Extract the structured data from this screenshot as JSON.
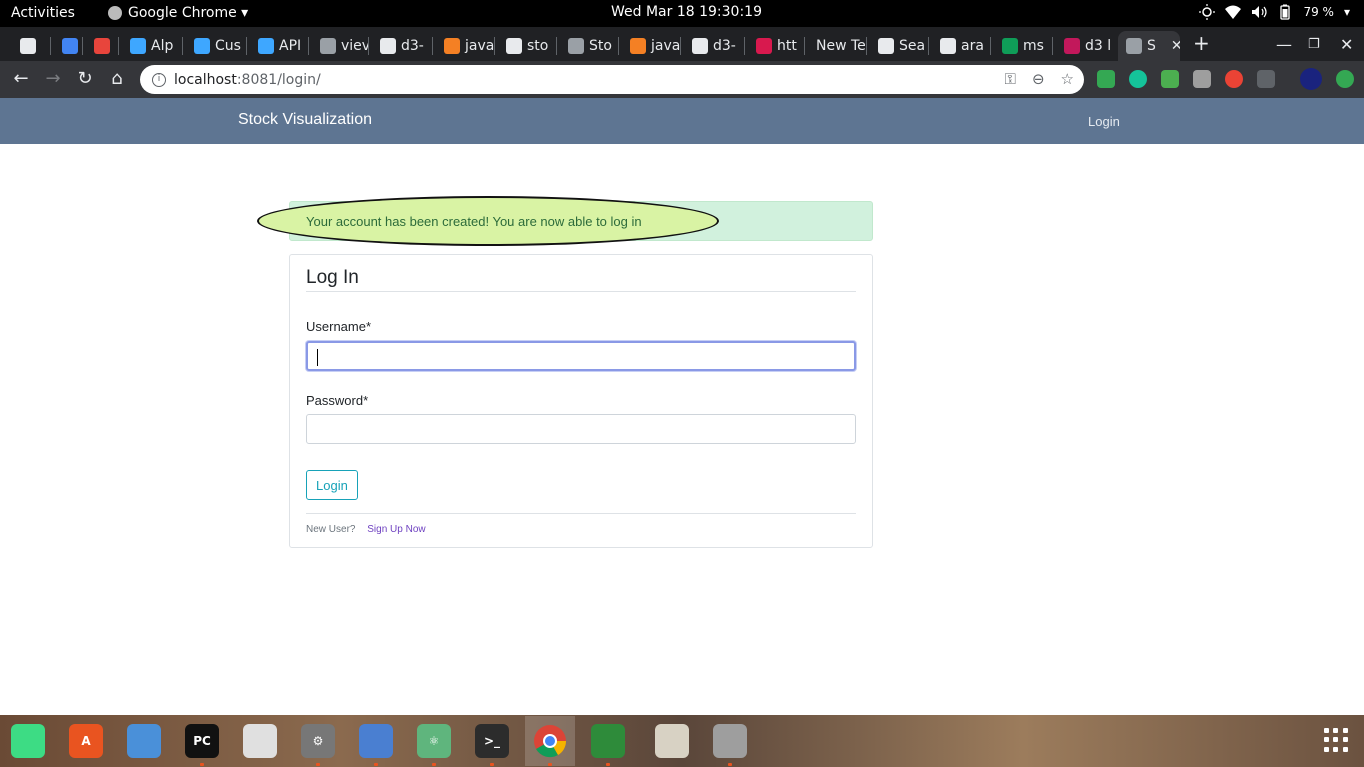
{
  "system": {
    "activities": "Activities",
    "app_menu": "Google Chrome ▾",
    "clock": "Wed Mar 18  19:30:19",
    "battery": "79 %"
  },
  "tabs": [
    {
      "label": "",
      "color": "#e8eaed"
    },
    {
      "label": "",
      "color": "#4285f4"
    },
    {
      "label": "",
      "color": "#e8453c"
    },
    {
      "label": "Alp",
      "color": "#3ea7ff"
    },
    {
      "label": "Cus",
      "color": "#3ea7ff"
    },
    {
      "label": "API",
      "color": "#3ea7ff"
    },
    {
      "label": "viev",
      "color": "#9aa0a6"
    },
    {
      "label": "d3-",
      "color": "#e8eaed"
    },
    {
      "label": "java",
      "color": "#f48024"
    },
    {
      "label": "sto",
      "color": "#e8eaed"
    },
    {
      "label": "Sto",
      "color": "#9aa0a6"
    },
    {
      "label": "java",
      "color": "#f48024"
    },
    {
      "label": "d3-",
      "color": "#e8eaed"
    },
    {
      "label": "htt",
      "color": "#d8194e"
    },
    {
      "label": "New Te",
      "color": ""
    },
    {
      "label": "Sea",
      "color": "#e8eaed"
    },
    {
      "label": "ara",
      "color": "#e8eaed"
    },
    {
      "label": "ms",
      "color": "#0f9d58"
    },
    {
      "label": "d3 l",
      "color": "#c2185b"
    },
    {
      "label": "S",
      "color": "#9aa0a6"
    }
  ],
  "address": {
    "host": "localhost",
    "path": ":8081/login/"
  },
  "page": {
    "brand": "Stock Visualization",
    "nav_login": "Login",
    "alert": "Your account has been created! You are now able to log in",
    "legend": "Log In",
    "username_label": "Username*",
    "username_value": "",
    "password_label": "Password*",
    "password_value": "",
    "login_button": "Login",
    "new_user": "New User?",
    "signup_link": "Sign Up Now"
  },
  "dock": [
    {
      "name": "android-studio-icon",
      "label": "",
      "color": "#3ddc84"
    },
    {
      "name": "software-center-icon",
      "label": "A",
      "color": "#e95420"
    },
    {
      "name": "text-editor-icon",
      "label": "",
      "color": "#4a90d9"
    },
    {
      "name": "pycharm-icon",
      "label": "PC",
      "color": "#111111"
    },
    {
      "name": "image-viewer-icon",
      "label": "",
      "color": "#e0e0e0"
    },
    {
      "name": "settings-icon",
      "label": "⚙",
      "color": "#777777"
    },
    {
      "name": "files-icon",
      "label": "",
      "color": "#4a7fd1"
    },
    {
      "name": "atom-icon",
      "label": "⚛",
      "color": "#5fb57d"
    },
    {
      "name": "terminal-icon",
      "label": ">_",
      "color": "#2c2c2c"
    },
    {
      "name": "chrome-icon",
      "label": "",
      "color": "#db4437"
    },
    {
      "name": "spreadsheet-icon",
      "label": "",
      "color": "#2e8b3a"
    },
    {
      "name": "archive-icon",
      "label": "",
      "color": "#d8d2c4"
    },
    {
      "name": "disk-icon",
      "label": "",
      "color": "#9e9e9e"
    }
  ]
}
